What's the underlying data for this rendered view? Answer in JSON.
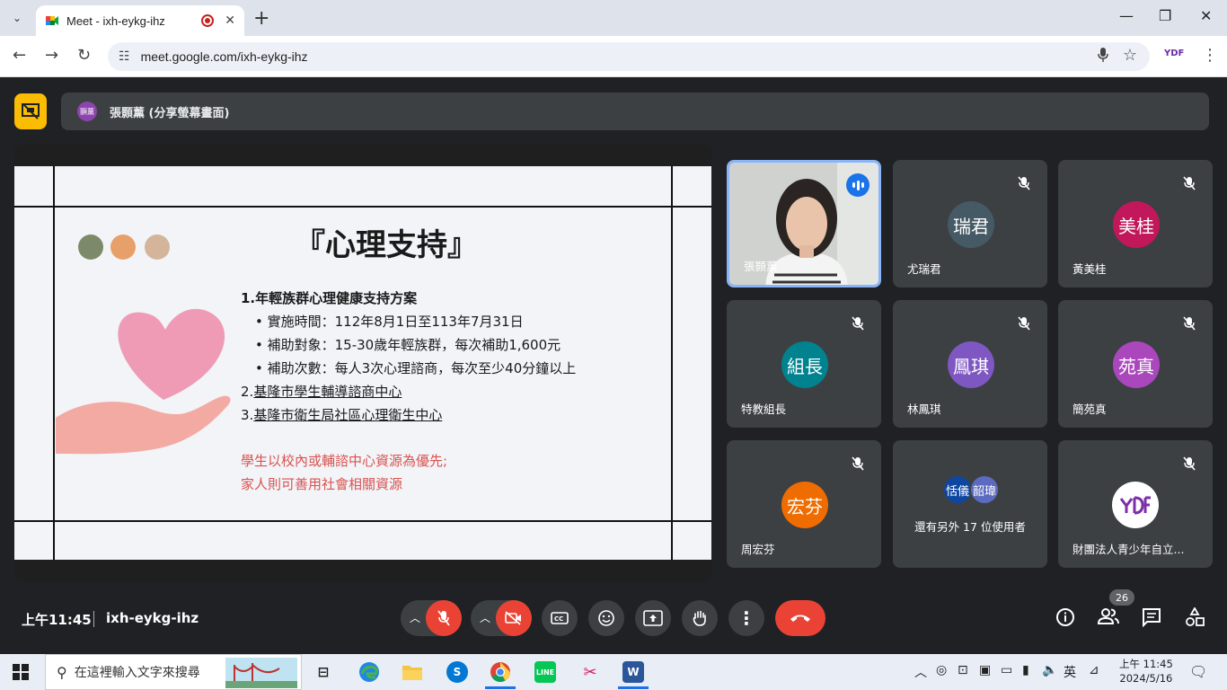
{
  "browser": {
    "tab_title": "Meet - ixh-eykg-ihz",
    "tab_close": "✕",
    "new_tab": "+",
    "url": "meet.google.com/ixh-eykg-ihz",
    "ext_label": "YDF"
  },
  "meet": {
    "presenter_initials": "顥薰",
    "presenter_label": "張顥薰 (分享螢幕畫面)",
    "time": "上午11:45",
    "meeting_code": "ixh-eykg-ihz",
    "participants_count": "26"
  },
  "slide": {
    "title": "『心理支持』",
    "dot_colors": [
      "#7d8a6a",
      "#e8a06a",
      "#d4b49a"
    ],
    "item1_num": "1.",
    "item1": "年輕族群心理健康支持方案",
    "bullet1": "• 實施時間：112年8月1日至113年7月31日",
    "bullet2": "• 補助對象：15-30歲年輕族群，每次補助1,600元",
    "bullet3": "• 補助次數：每人3次心理諮商，每次至少40分鐘以上",
    "item2_num": "2.",
    "item2": "基隆市學生輔導諮商中心",
    "item3_num": "3.",
    "item3": "基隆市衛生局社區心理衛生中心",
    "note1": "學生以校內或輔諮中心資源為優先;",
    "note2": "家人則可善用社會相關資源"
  },
  "tiles": [
    {
      "name": "張顥薰",
      "initials": "",
      "color": ""
    },
    {
      "name": "尤瑞君",
      "initials": "瑞君",
      "color": "#455a64"
    },
    {
      "name": "黃美桂",
      "initials": "美桂",
      "color": "#c2185b"
    },
    {
      "name": "特教組長",
      "initials": "組長",
      "color": "#00838f"
    },
    {
      "name": "林鳳琪",
      "initials": "鳳琪",
      "color": "#7e57c2"
    },
    {
      "name": "簡苑真",
      "initials": "苑真",
      "color": "#ab47bc"
    },
    {
      "name": "周宏芬",
      "initials": "宏芬",
      "color": "#ef6c00"
    },
    {
      "name": "還有另外 17 位使用者",
      "initials": "",
      "color": ""
    },
    {
      "name": "財團法人青少年自立...",
      "initials": "",
      "color": ""
    }
  ],
  "others": {
    "a1": "恬儀",
    "a1_color": "#0d47a1",
    "a2": "韶瑋",
    "a2_color": "#5c6bc0"
  },
  "taskbar": {
    "search_placeholder": "在這裡輸入文字來搜尋",
    "ime": "英",
    "clock_time": "上午 11:45",
    "clock_date": "2024/5/16"
  }
}
